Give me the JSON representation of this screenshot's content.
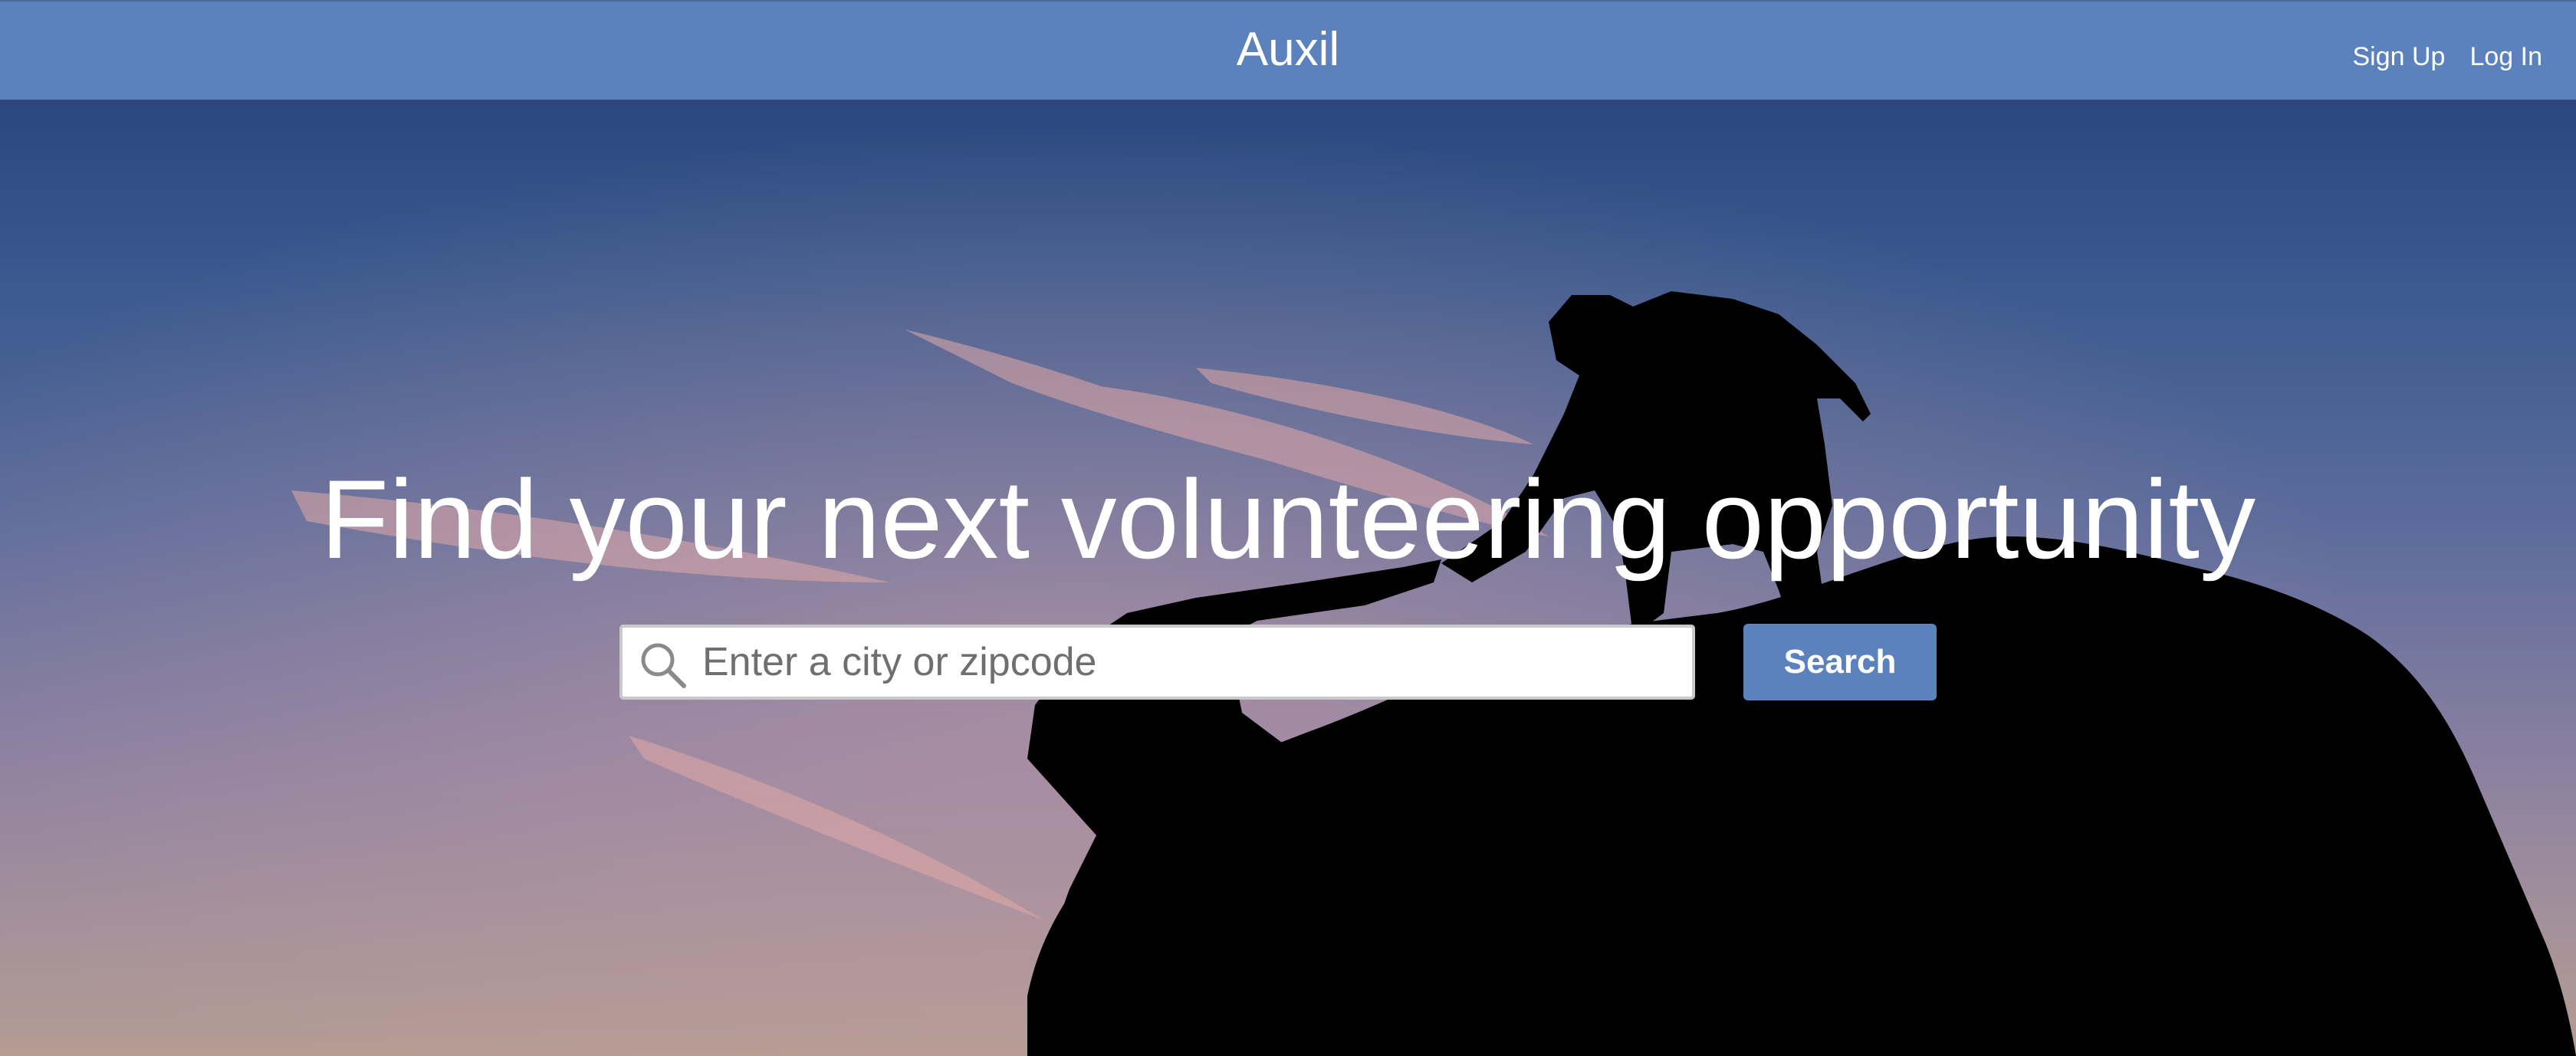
{
  "header": {
    "brand": "Auxil",
    "links": [
      {
        "label": "Sign Up"
      },
      {
        "label": "Log In"
      }
    ]
  },
  "hero": {
    "headline": "Find your next volunteering opportunity",
    "search": {
      "placeholder": "Enter a city or zipcode",
      "value": "",
      "button_label": "Search"
    }
  },
  "colors": {
    "nav_background": "#5b82bd",
    "accent": "#5b82bd",
    "text_on_dark": "#ffffff"
  },
  "icons": {
    "search": "search-icon"
  }
}
